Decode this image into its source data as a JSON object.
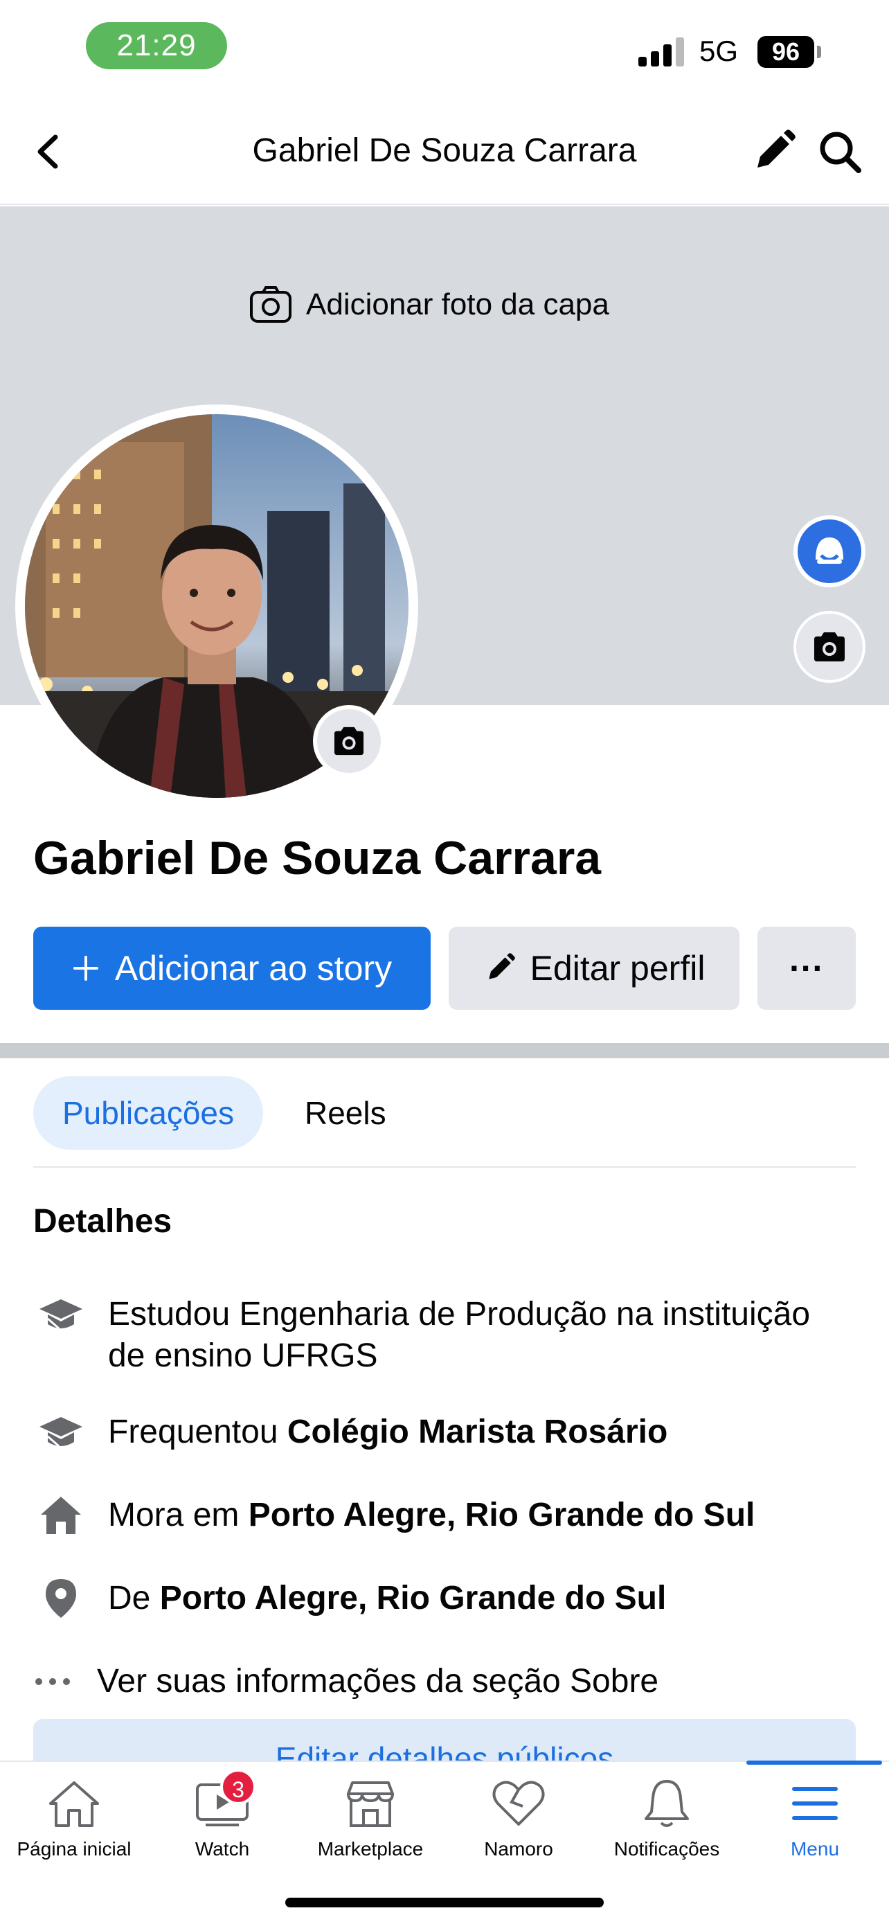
{
  "status_bar": {
    "time": "21:29",
    "network": "5G",
    "battery": "96"
  },
  "header": {
    "title": "Gabriel De Souza Carrara"
  },
  "cover": {
    "add_cover_label": "Adicionar foto da capa"
  },
  "profile": {
    "name": "Gabriel De Souza Carrara",
    "story_button": "Adicionar ao story",
    "edit_button": "Editar perfil",
    "more_button": "···"
  },
  "tabs": [
    {
      "label": "Publicações",
      "active": true
    },
    {
      "label": "Reels",
      "active": false
    }
  ],
  "details": {
    "title": "Detalhes",
    "items": [
      {
        "icon": "graduation-cap-icon",
        "line1": "Estudou Engenharia de Produção na instituição",
        "line2": "de ensino UFRGS"
      },
      {
        "icon": "graduation-cap-icon",
        "prefix": "Frequentou ",
        "bold": "Colégio Marista Rosário"
      },
      {
        "icon": "home-icon",
        "prefix": "Mora em ",
        "bold": "Porto Alegre, Rio Grande do Sul"
      },
      {
        "icon": "location-pin-icon",
        "prefix": "De ",
        "bold": "Porto Alegre, Rio Grande do Sul"
      },
      {
        "icon": "more-dots-icon",
        "prefix": "Ver suas informações da seção Sobre"
      }
    ],
    "edit_public_button": "Editar detalhes públicos"
  },
  "bottom_nav": [
    {
      "label": "Página inicial",
      "icon": "home-icon"
    },
    {
      "label": "Watch",
      "icon": "watch-icon",
      "badge": "3"
    },
    {
      "label": "Marketplace",
      "icon": "marketplace-icon"
    },
    {
      "label": "Namoro",
      "icon": "heart-icon"
    },
    {
      "label": "Notificações",
      "icon": "bell-icon"
    },
    {
      "label": "Menu",
      "icon": "menu-icon",
      "active": true
    }
  ],
  "colors": {
    "accent": "#1b74e4",
    "cover": "#d7dadf",
    "badge": "#e41e3f"
  }
}
